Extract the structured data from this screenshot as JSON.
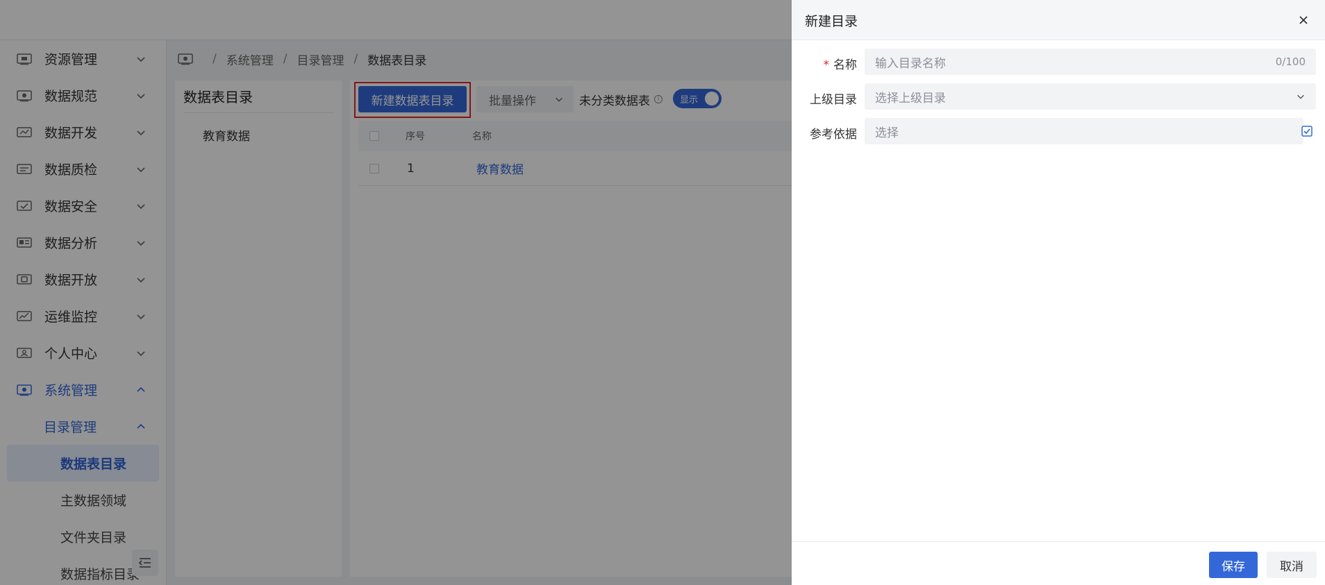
{
  "sidebar": {
    "menu": [
      {
        "label": "资源管理",
        "icon": "resource-icon"
      },
      {
        "label": "数据规范",
        "icon": "standard-icon"
      },
      {
        "label": "数据开发",
        "icon": "develop-icon"
      },
      {
        "label": "数据质检",
        "icon": "quality-icon"
      },
      {
        "label": "数据安全",
        "icon": "security-icon"
      },
      {
        "label": "数据分析",
        "icon": "analysis-icon"
      },
      {
        "label": "数据开放",
        "icon": "open-icon"
      },
      {
        "label": "运维监控",
        "icon": "monitor-icon"
      },
      {
        "label": "个人中心",
        "icon": "user-icon"
      },
      {
        "label": "系统管理",
        "icon": "system-icon"
      }
    ],
    "submenu": {
      "label": "目录管理"
    },
    "leaves": [
      "数据表目录",
      "主数据领域",
      "文件夹目录",
      "数据指标目录"
    ],
    "current_leaf_index": 0
  },
  "breadcrumb": {
    "items": [
      "系统管理",
      "目录管理",
      "数据表目录"
    ]
  },
  "left_panel": {
    "title": "数据表目录",
    "tree": [
      "教育数据"
    ]
  },
  "toolbar": {
    "new_button": "新建数据表目录",
    "batch_button": "批量操作",
    "uncategorized_label": "未分类数据表",
    "info_glyph": "i",
    "toggle_label": "显示",
    "toggle_on": true
  },
  "table": {
    "columns": [
      "序号",
      "名称"
    ],
    "rows": [
      {
        "no": "1",
        "name": "教育数据"
      }
    ]
  },
  "drawer": {
    "title": "新建目录",
    "fields": {
      "name": {
        "label": "名称",
        "required": true,
        "placeholder": "输入目录名称",
        "count": "0/100"
      },
      "parent": {
        "label": "上级目录",
        "placeholder": "选择上级目录"
      },
      "reference": {
        "label": "参考依据",
        "placeholder": "选择",
        "checked": true
      }
    },
    "save_button": "保存",
    "cancel_button": "取消"
  },
  "colors": {
    "primary": "#3468d8",
    "highlight_border": "#e0262a",
    "required": "#e0262a"
  }
}
